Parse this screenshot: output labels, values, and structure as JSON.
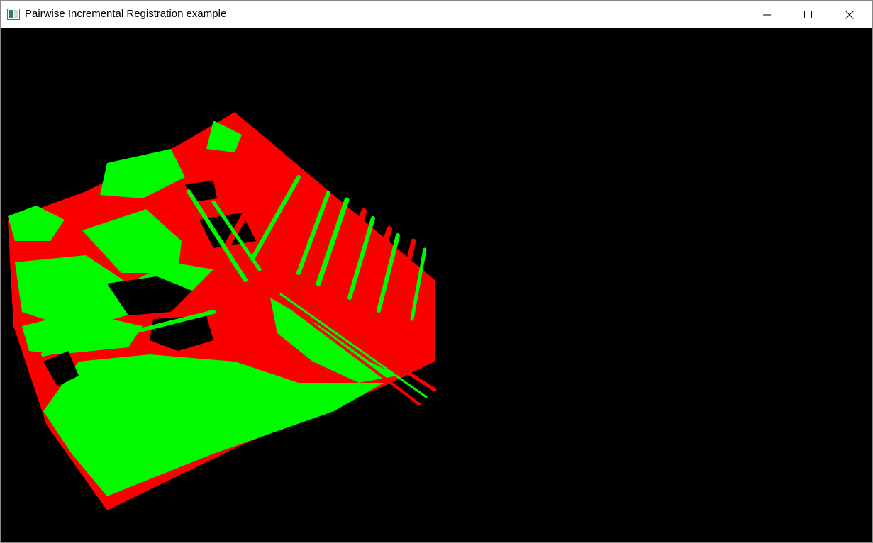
{
  "window": {
    "title": "Pairwise Incremental Registration example",
    "controls": {
      "minimize_icon": "minimize-icon",
      "maximize_icon": "maximize-icon",
      "close_icon": "close-icon"
    }
  },
  "viewer": {
    "background_color": "#000000",
    "source_cloud_color": "#ff0000",
    "target_cloud_color": "#00ff00"
  }
}
